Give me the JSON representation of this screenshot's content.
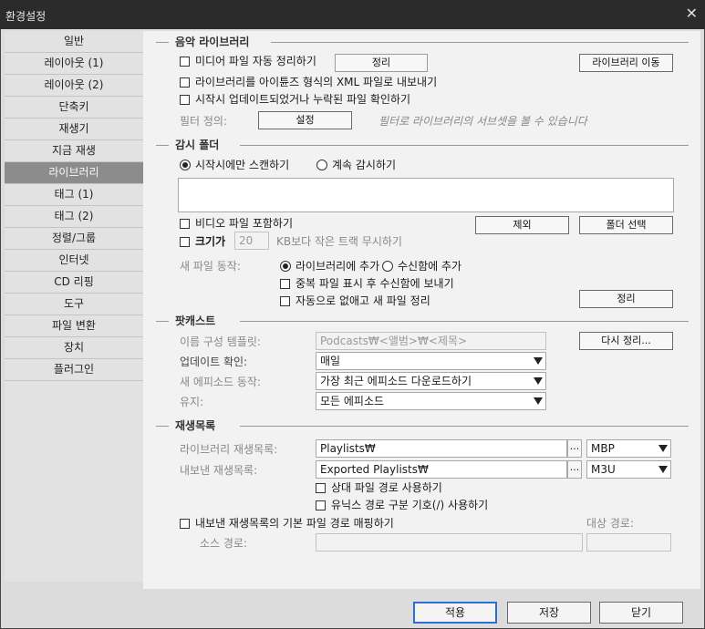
{
  "window": {
    "title": "환경설정",
    "close_glyph": "✕"
  },
  "sidebar": {
    "items": [
      "일반",
      "레이아웃 (1)",
      "레이아웃 (2)",
      "단축키",
      "재생기",
      "지금 재생",
      "라이브러리",
      "태그 (1)",
      "태그 (2)",
      "정렬/그룹",
      "인터넷",
      "CD 리핑",
      "도구",
      "파일 변환",
      "장치",
      "플러그인"
    ],
    "active": "라이브러리"
  },
  "music_library": {
    "section": "음악 라이브러리",
    "auto_organize": "미디어 파일 자동 정리하기",
    "organize_button": "정리",
    "move_library_button": "라이브러리 이동",
    "export_xml": "라이브러리를 아이튠즈 형식의 XML 파일로 내보내기",
    "check_on_start": "시작시 업데이트되었거나 누락된 파일 확인하기",
    "filter_label": "필터 정의:",
    "filter_button": "설정",
    "filter_hint": "필터로 라이브러리의 서브셋을 볼 수 있습니다"
  },
  "watch_folders": {
    "section": "감시 폴더",
    "scan_on_start": "시작시에만 스캔하기",
    "continuous": "계속 감시하기",
    "include_video": "비디오 파일 포함하기",
    "remove_button": "제외",
    "select_folder_button": "폴더 선택",
    "size_label": "크기가",
    "size_value": "20",
    "size_suffix": "KB보다 작은 트랙 무시하기",
    "new_file_label": "새 파일 동작:",
    "add_to_library": "라이브러리에 추가",
    "add_to_inbox": "수신함에 추가",
    "send_duplicates": "중복 파일 표시 후 수신함에 보내기",
    "auto_remove": "자동으로 없애고 새 파일 정리",
    "organize_button": "정리"
  },
  "podcasts": {
    "section": "팟캐스트",
    "naming_label": "이름 구성 템플릿:",
    "naming_value": "Podcasts₩<앨범>₩<제목>",
    "reorganize_button": "다시 정리...",
    "update_label": "업데이트 확인:",
    "update_value": "매일",
    "episode_label": "새 에피소드 동작:",
    "episode_value": "가장 최근 에피소드 다운로드하기",
    "keep_label": "유지:",
    "keep_value": "모든 에피소드"
  },
  "playlists": {
    "section": "재생목록",
    "library_label": "라이브러리 재생목록:",
    "library_value": "Playlists₩",
    "library_format": "MBP",
    "export_label": "내보낸 재생목록:",
    "export_value": "Exported Playlists₩",
    "export_format": "M3U",
    "browse_glyph": "...",
    "relative_paths": "상대 파일 경로 사용하기",
    "unix_separator": "유닉스 경로 구분 기호(/) 사용하기",
    "map_base_path": "내보낸 재생목록의 기본 파일 경로 매핑하기",
    "target_path_label": "대상 경로:",
    "source_path_label": "소스 경로:"
  },
  "footer": {
    "apply": "적용",
    "save": "저장",
    "close": "닫기"
  },
  "colors": {
    "active_sidebar": "#8c8c8c",
    "primary_border": "#2a6fd6",
    "titlebar": "#2b2b2b"
  }
}
